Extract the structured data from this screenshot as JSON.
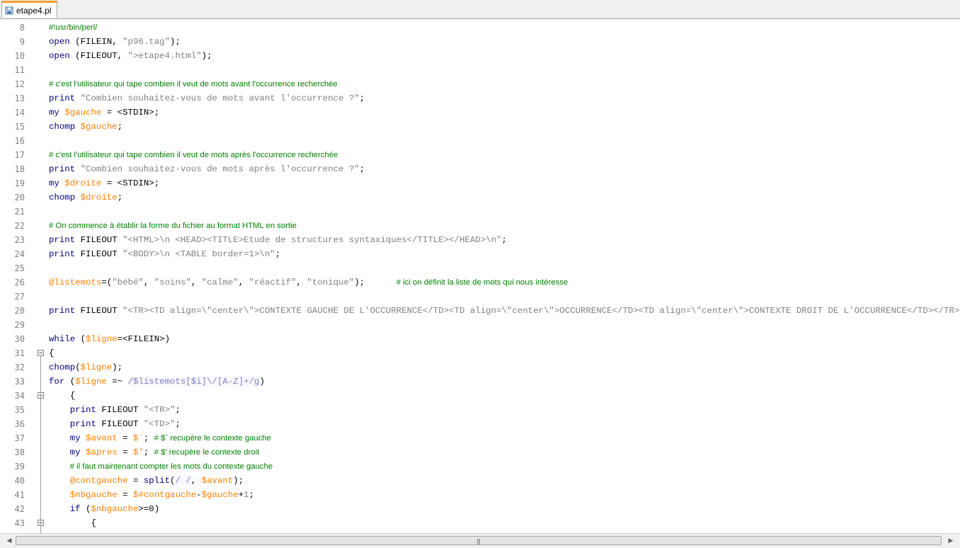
{
  "tab": {
    "label": "etape4.pl",
    "icon": "file-icon"
  },
  "lines": [
    {
      "n": "8",
      "t": [
        {
          "c": "cm",
          "s": "#!usr/bin/perl/"
        }
      ]
    },
    {
      "n": "9",
      "t": [
        {
          "c": "kw",
          "s": "open"
        },
        {
          "c": "pl",
          "s": " (FILEIN, "
        },
        {
          "c": "str",
          "s": "\"p96.tag\""
        },
        {
          "c": "pl",
          "s": ");"
        }
      ]
    },
    {
      "n": "10",
      "t": [
        {
          "c": "kw",
          "s": "open"
        },
        {
          "c": "pl",
          "s": " (FILEOUT, "
        },
        {
          "c": "str",
          "s": "\">etape4.html\""
        },
        {
          "c": "pl",
          "s": ");"
        }
      ]
    },
    {
      "n": "11",
      "t": []
    },
    {
      "n": "12",
      "t": [
        {
          "c": "cm",
          "s": "# c'est l'utilisateur qui tape combien il veut de mots avant l'occurrence recherchée"
        }
      ]
    },
    {
      "n": "13",
      "t": [
        {
          "c": "kw",
          "s": "print"
        },
        {
          "c": "pl",
          "s": " "
        },
        {
          "c": "str",
          "s": "\"Combien souhaitez-vous de mots avant l'occurrence ?\""
        },
        {
          "c": "pl",
          "s": ";"
        }
      ]
    },
    {
      "n": "14",
      "t": [
        {
          "c": "kw",
          "s": "my"
        },
        {
          "c": "pl",
          "s": " "
        },
        {
          "c": "var",
          "s": "$gauche"
        },
        {
          "c": "pl",
          "s": " = <STDIN>;"
        }
      ]
    },
    {
      "n": "15",
      "t": [
        {
          "c": "kw",
          "s": "chomp"
        },
        {
          "c": "pl",
          "s": " "
        },
        {
          "c": "var",
          "s": "$gauche"
        },
        {
          "c": "pl",
          "s": ";"
        }
      ]
    },
    {
      "n": "16",
      "t": []
    },
    {
      "n": "17",
      "t": [
        {
          "c": "cm",
          "s": "# c'est l'utilisateur qui tape combien il veut de mots après l'occurrence recherchée"
        }
      ]
    },
    {
      "n": "18",
      "t": [
        {
          "c": "kw",
          "s": "print"
        },
        {
          "c": "pl",
          "s": " "
        },
        {
          "c": "str",
          "s": "\"Combien souhaitez-vous de mots après l'occurrence ?\""
        },
        {
          "c": "pl",
          "s": ";"
        }
      ]
    },
    {
      "n": "19",
      "t": [
        {
          "c": "kw",
          "s": "my"
        },
        {
          "c": "pl",
          "s": " "
        },
        {
          "c": "var",
          "s": "$droite"
        },
        {
          "c": "pl",
          "s": " = <STDIN>;"
        }
      ]
    },
    {
      "n": "20",
      "t": [
        {
          "c": "kw",
          "s": "chomp"
        },
        {
          "c": "pl",
          "s": " "
        },
        {
          "c": "var",
          "s": "$droite"
        },
        {
          "c": "pl",
          "s": ";"
        }
      ]
    },
    {
      "n": "21",
      "t": []
    },
    {
      "n": "22",
      "t": [
        {
          "c": "cm",
          "s": "# On commence à établir la forme du fichier au format HTML en sortie"
        }
      ]
    },
    {
      "n": "23",
      "t": [
        {
          "c": "kw",
          "s": "print"
        },
        {
          "c": "pl",
          "s": " FILEOUT "
        },
        {
          "c": "str",
          "s": "\"<HTML>\\n <HEAD><TITLE>Etude de structures syntaxiques</TITLE></HEAD>\\n\""
        },
        {
          "c": "pl",
          "s": ";"
        }
      ]
    },
    {
      "n": "24",
      "t": [
        {
          "c": "kw",
          "s": "print"
        },
        {
          "c": "pl",
          "s": " FILEOUT "
        },
        {
          "c": "str",
          "s": "\"<BODY>\\n <TABLE border=1>\\n\""
        },
        {
          "c": "pl",
          "s": ";"
        }
      ]
    },
    {
      "n": "25",
      "t": []
    },
    {
      "n": "26",
      "t": [
        {
          "c": "var",
          "s": "@listemots"
        },
        {
          "c": "pl",
          "s": "=("
        },
        {
          "c": "str",
          "s": "\"bébé\""
        },
        {
          "c": "pl",
          "s": ", "
        },
        {
          "c": "str",
          "s": "\"soins\""
        },
        {
          "c": "pl",
          "s": ", "
        },
        {
          "c": "str",
          "s": "\"calme\""
        },
        {
          "c": "pl",
          "s": ", "
        },
        {
          "c": "str",
          "s": "\"réactif\""
        },
        {
          "c": "pl",
          "s": ", "
        },
        {
          "c": "str",
          "s": "\"tonique\""
        },
        {
          "c": "pl",
          "s": ");      "
        },
        {
          "c": "cm",
          "s": "# ici on définit la liste de mots qui nous intéresse"
        }
      ]
    },
    {
      "n": "27",
      "t": []
    },
    {
      "n": "28",
      "t": [
        {
          "c": "kw",
          "s": "print"
        },
        {
          "c": "pl",
          "s": " FILEOUT "
        },
        {
          "c": "str",
          "s": "\"<TR><TD align=\\\"center\\\">CONTEXTE GAUCHE DE L'OCCURRENCE</TD><TD align=\\\"center\\\">OCCURRENCE</TD><TD align=\\\"center\\\">CONTEXTE DROIT DE L'OCCURRENCE</TD></TR>\\n\""
        },
        {
          "c": "pl",
          "s": ";"
        }
      ]
    },
    {
      "n": "29",
      "t": []
    },
    {
      "n": "30",
      "t": [
        {
          "c": "kw",
          "s": "while"
        },
        {
          "c": "pl",
          "s": " ("
        },
        {
          "c": "var",
          "s": "$ligne"
        },
        {
          "c": "pl",
          "s": "=<FILEIN>)"
        }
      ]
    },
    {
      "n": "31",
      "fold": true,
      "t": [
        {
          "c": "pl",
          "s": "{"
        }
      ]
    },
    {
      "n": "32",
      "t": [
        {
          "c": "sub",
          "s": "chomp"
        },
        {
          "c": "pl",
          "s": "("
        },
        {
          "c": "var",
          "s": "$ligne"
        },
        {
          "c": "pl",
          "s": ");"
        }
      ]
    },
    {
      "n": "33",
      "t": [
        {
          "c": "kw",
          "s": "for"
        },
        {
          "c": "pl",
          "s": " ("
        },
        {
          "c": "var",
          "s": "$ligne"
        },
        {
          "c": "pl",
          "s": " =~ "
        },
        {
          "c": "rx",
          "s": "/$listemots[$i]\\/[A-Z]+/g"
        },
        {
          "c": "pl",
          "s": ")"
        }
      ]
    },
    {
      "n": "34",
      "fold": true,
      "t": [
        {
          "c": "pl",
          "s": "    {"
        }
      ]
    },
    {
      "n": "35",
      "t": [
        {
          "c": "pl",
          "s": "    "
        },
        {
          "c": "kw",
          "s": "print"
        },
        {
          "c": "pl",
          "s": " FILEOUT "
        },
        {
          "c": "str",
          "s": "\"<TR>\""
        },
        {
          "c": "pl",
          "s": ";"
        }
      ]
    },
    {
      "n": "36",
      "t": [
        {
          "c": "pl",
          "s": "    "
        },
        {
          "c": "kw",
          "s": "print"
        },
        {
          "c": "pl",
          "s": " FILEOUT "
        },
        {
          "c": "str",
          "s": "\"<TD>\""
        },
        {
          "c": "pl",
          "s": ";"
        }
      ]
    },
    {
      "n": "37",
      "t": [
        {
          "c": "pl",
          "s": "    "
        },
        {
          "c": "kw",
          "s": "my"
        },
        {
          "c": "pl",
          "s": " "
        },
        {
          "c": "var",
          "s": "$avant"
        },
        {
          "c": "pl",
          "s": " = "
        },
        {
          "c": "var",
          "s": "$`"
        },
        {
          "c": "pl",
          "s": "; "
        },
        {
          "c": "cm",
          "s": "# $` recupère le contexte gauche"
        }
      ]
    },
    {
      "n": "38",
      "t": [
        {
          "c": "pl",
          "s": "    "
        },
        {
          "c": "kw",
          "s": "my"
        },
        {
          "c": "pl",
          "s": " "
        },
        {
          "c": "var",
          "s": "$apres"
        },
        {
          "c": "pl",
          "s": " = "
        },
        {
          "c": "var",
          "s": "$'"
        },
        {
          "c": "pl",
          "s": "; "
        },
        {
          "c": "cm",
          "s": "# $' recupère le contexte droit"
        }
      ]
    },
    {
      "n": "39",
      "t": [
        {
          "c": "pl",
          "s": "    "
        },
        {
          "c": "cm",
          "s": "# il faut maintenant compter les mots du contexte gauche"
        }
      ]
    },
    {
      "n": "40",
      "t": [
        {
          "c": "pl",
          "s": "    "
        },
        {
          "c": "var",
          "s": "@contgauche"
        },
        {
          "c": "pl",
          "s": " = "
        },
        {
          "c": "sub",
          "s": "split"
        },
        {
          "c": "pl",
          "s": "("
        },
        {
          "c": "rx",
          "s": "/ /"
        },
        {
          "c": "pl",
          "s": ", "
        },
        {
          "c": "var",
          "s": "$avant"
        },
        {
          "c": "pl",
          "s": ");"
        }
      ]
    },
    {
      "n": "41",
      "t": [
        {
          "c": "pl",
          "s": "    "
        },
        {
          "c": "var",
          "s": "$nbgauche"
        },
        {
          "c": "pl",
          "s": " = "
        },
        {
          "c": "var",
          "s": "$#contgauche"
        },
        {
          "c": "pl",
          "s": "-"
        },
        {
          "c": "var",
          "s": "$gauche"
        },
        {
          "c": "pl",
          "s": "+"
        },
        {
          "c": "str",
          "s": "1"
        },
        {
          "c": "pl",
          "s": ";"
        }
      ]
    },
    {
      "n": "42",
      "t": [
        {
          "c": "pl",
          "s": "    "
        },
        {
          "c": "kw",
          "s": "if"
        },
        {
          "c": "pl",
          "s": " ("
        },
        {
          "c": "var",
          "s": "$nbgauche"
        },
        {
          "c": "pl",
          "s": ">=0)"
        }
      ]
    },
    {
      "n": "43",
      "fold": true,
      "t": [
        {
          "c": "pl",
          "s": "        {"
        }
      ]
    }
  ],
  "scrollbar": {
    "left_arrow": "◀",
    "right_arrow": "▶",
    "grip": "|||"
  }
}
